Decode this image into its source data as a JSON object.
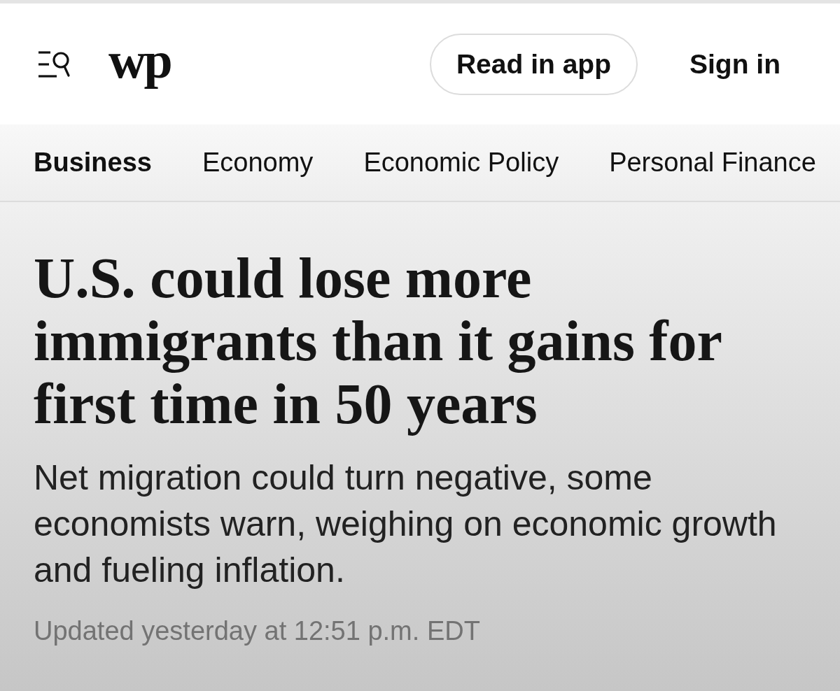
{
  "header": {
    "logo": "wp",
    "buttons": [
      {
        "label": "Read in app",
        "kind": "outlined"
      },
      {
        "label": "Sign in",
        "kind": "plain"
      }
    ]
  },
  "nav": {
    "items": [
      {
        "label": "Business",
        "selected": true
      },
      {
        "label": "Economy",
        "selected": false
      },
      {
        "label": "Economic Policy",
        "selected": false
      },
      {
        "label": "Personal Finance",
        "selected": false
      }
    ]
  },
  "article": {
    "headline": "U.S. could lose more immigrants than it gains for first time in 50 years",
    "subheadline": "Net migration could turn negative, some economists warn, weighing on economic growth and fueling inflation.",
    "timestamp": "Updated yesterday at 12:51 p.m. EDT"
  }
}
